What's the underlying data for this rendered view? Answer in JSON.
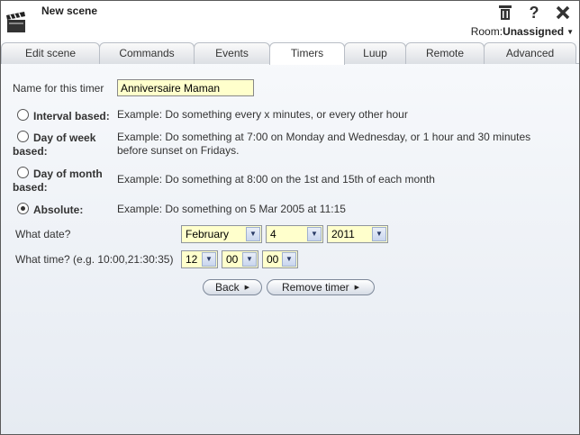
{
  "header": {
    "title": "New scene",
    "room_label": "Room:",
    "room_value": "Unassigned",
    "icons": [
      "trash-icon",
      "help-icon",
      "close-icon"
    ]
  },
  "tabs": [
    {
      "label": "Edit scene",
      "active": false
    },
    {
      "label": "Commands",
      "active": false
    },
    {
      "label": "Events",
      "active": false
    },
    {
      "label": "Timers",
      "active": true
    },
    {
      "label": "Luup",
      "active": false
    },
    {
      "label": "Remote",
      "active": false
    },
    {
      "label": "Advanced",
      "active": false
    }
  ],
  "form": {
    "name_label": "Name for this timer",
    "name_value": "Anniversaire Maman",
    "options": [
      {
        "label": "Interval based:",
        "example": "Example: Do something every x minutes, or every other hour",
        "checked": false
      },
      {
        "label": "Day of week based:",
        "example": "Example: Do something at 7:00 on Monday and Wednesday, or 1 hour and 30 minutes before sunset on Fridays.",
        "checked": false
      },
      {
        "label": "Day of month based:",
        "example": "Example: Do something at 8:00 on the 1st and 15th of each month",
        "checked": false
      },
      {
        "label": "Absolute:",
        "example": "Example: Do something on 5 Mar 2005 at 11:15",
        "checked": true
      }
    ],
    "date_label": "What date?",
    "date": {
      "month": "February",
      "day": "4",
      "year": "2011"
    },
    "time_label": "What time? (e.g. 10:00,21:30:35)",
    "time": {
      "hour": "12",
      "minute": "00",
      "second": "00"
    },
    "back_label": "Back",
    "remove_label": "Remove timer"
  }
}
